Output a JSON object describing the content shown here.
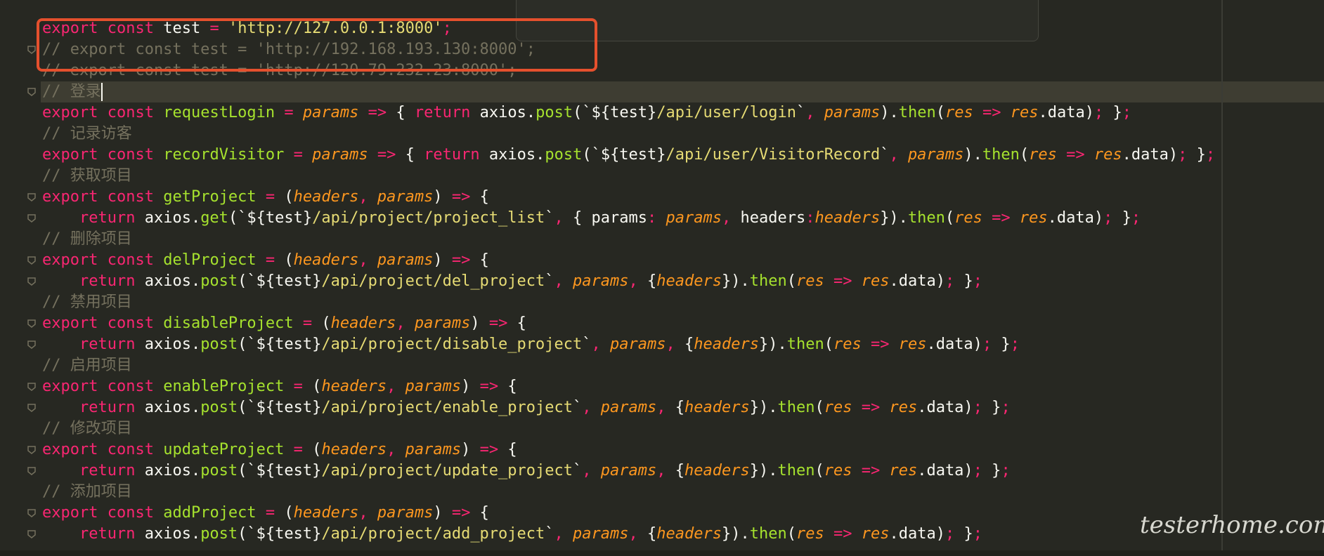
{
  "editor": {
    "lines": [
      [
        [
          "kw",
          "export"
        ],
        [
          "pl",
          " "
        ],
        [
          "kw",
          "const"
        ],
        [
          "pl",
          " test "
        ],
        [
          "op",
          "="
        ],
        [
          "pl",
          " "
        ],
        [
          "st",
          "'http://127.0.0.1:8000'"
        ],
        [
          "op",
          ";"
        ]
      ],
      [
        [
          "cm",
          "// export const test = 'http://192.168.193.130:8000';"
        ]
      ],
      [
        [
          "cm",
          "// export const test = 'http://120.79.232.23:8000';"
        ]
      ],
      [
        [
          "cm",
          "// 登录"
        ]
      ],
      [
        [
          "kw",
          "export"
        ],
        [
          "pl",
          " "
        ],
        [
          "kw",
          "const"
        ],
        [
          "pl",
          " "
        ],
        [
          "fn",
          "requestLogin"
        ],
        [
          "pl",
          " "
        ],
        [
          "op",
          "="
        ],
        [
          "pl",
          " "
        ],
        [
          "pr",
          "params"
        ],
        [
          "pl",
          " "
        ],
        [
          "op",
          "=>"
        ],
        [
          "pl",
          " { "
        ],
        [
          "kw",
          "return"
        ],
        [
          "pl",
          " axios."
        ],
        [
          "fn",
          "post"
        ],
        [
          "pl",
          "(`${test}"
        ],
        [
          "st",
          "/api/user/login"
        ],
        [
          "pl",
          "`"
        ],
        [
          "op",
          ","
        ],
        [
          "pl",
          " "
        ],
        [
          "pr",
          "params"
        ],
        [
          "pl",
          ")."
        ],
        [
          "fn",
          "then"
        ],
        [
          "pl",
          "("
        ],
        [
          "pr",
          "res"
        ],
        [
          "pl",
          " "
        ],
        [
          "op",
          "=>"
        ],
        [
          "pl",
          " "
        ],
        [
          "pr",
          "res"
        ],
        [
          "pl",
          ".data)"
        ],
        [
          "op",
          ";"
        ],
        [
          "pl",
          " }"
        ],
        [
          "op",
          ";"
        ]
      ],
      [
        [
          "cm",
          "// 记录访客"
        ]
      ],
      [
        [
          "kw",
          "export"
        ],
        [
          "pl",
          " "
        ],
        [
          "kw",
          "const"
        ],
        [
          "pl",
          " "
        ],
        [
          "fn",
          "recordVisitor"
        ],
        [
          "pl",
          " "
        ],
        [
          "op",
          "="
        ],
        [
          "pl",
          " "
        ],
        [
          "pr",
          "params"
        ],
        [
          "pl",
          " "
        ],
        [
          "op",
          "=>"
        ],
        [
          "pl",
          " { "
        ],
        [
          "kw",
          "return"
        ],
        [
          "pl",
          " axios."
        ],
        [
          "fn",
          "post"
        ],
        [
          "pl",
          "(`${test}"
        ],
        [
          "st",
          "/api/user/VisitorRecord"
        ],
        [
          "pl",
          "`"
        ],
        [
          "op",
          ","
        ],
        [
          "pl",
          " "
        ],
        [
          "pr",
          "params"
        ],
        [
          "pl",
          ")."
        ],
        [
          "fn",
          "then"
        ],
        [
          "pl",
          "("
        ],
        [
          "pr",
          "res"
        ],
        [
          "pl",
          " "
        ],
        [
          "op",
          "=>"
        ],
        [
          "pl",
          " "
        ],
        [
          "pr",
          "res"
        ],
        [
          "pl",
          ".data)"
        ],
        [
          "op",
          ";"
        ],
        [
          "pl",
          " }"
        ],
        [
          "op",
          ";"
        ]
      ],
      [
        [
          "cm",
          "// 获取项目"
        ]
      ],
      [
        [
          "kw",
          "export"
        ],
        [
          "pl",
          " "
        ],
        [
          "kw",
          "const"
        ],
        [
          "pl",
          " "
        ],
        [
          "fn",
          "getProject"
        ],
        [
          "pl",
          " "
        ],
        [
          "op",
          "="
        ],
        [
          "pl",
          " ("
        ],
        [
          "pr",
          "headers"
        ],
        [
          "op",
          ","
        ],
        [
          "pl",
          " "
        ],
        [
          "pr",
          "params"
        ],
        [
          "pl",
          ") "
        ],
        [
          "op",
          "=>"
        ],
        [
          "pl",
          " {"
        ]
      ],
      [
        [
          "pl",
          "    "
        ],
        [
          "kw",
          "return"
        ],
        [
          "pl",
          " axios."
        ],
        [
          "fn",
          "get"
        ],
        [
          "pl",
          "(`${test}"
        ],
        [
          "st",
          "/api/project/project_list"
        ],
        [
          "pl",
          "`"
        ],
        [
          "op",
          ","
        ],
        [
          "pl",
          " { params"
        ],
        [
          "op",
          ":"
        ],
        [
          "pl",
          " "
        ],
        [
          "pr",
          "params"
        ],
        [
          "op",
          ","
        ],
        [
          "pl",
          " headers"
        ],
        [
          "op",
          ":"
        ],
        [
          "pr",
          "headers"
        ],
        [
          "pl",
          "})."
        ],
        [
          "fn",
          "then"
        ],
        [
          "pl",
          "("
        ],
        [
          "pr",
          "res"
        ],
        [
          "pl",
          " "
        ],
        [
          "op",
          "=>"
        ],
        [
          "pl",
          " "
        ],
        [
          "pr",
          "res"
        ],
        [
          "pl",
          ".data)"
        ],
        [
          "op",
          ";"
        ],
        [
          "pl",
          " }"
        ],
        [
          "op",
          ";"
        ]
      ],
      [
        [
          "cm",
          "// 删除项目"
        ]
      ],
      [
        [
          "kw",
          "export"
        ],
        [
          "pl",
          " "
        ],
        [
          "kw",
          "const"
        ],
        [
          "pl",
          " "
        ],
        [
          "fn",
          "delProject"
        ],
        [
          "pl",
          " "
        ],
        [
          "op",
          "="
        ],
        [
          "pl",
          " ("
        ],
        [
          "pr",
          "headers"
        ],
        [
          "op",
          ","
        ],
        [
          "pl",
          " "
        ],
        [
          "pr",
          "params"
        ],
        [
          "pl",
          ") "
        ],
        [
          "op",
          "=>"
        ],
        [
          "pl",
          " {"
        ]
      ],
      [
        [
          "pl",
          "    "
        ],
        [
          "kw",
          "return"
        ],
        [
          "pl",
          " axios."
        ],
        [
          "fn",
          "post"
        ],
        [
          "pl",
          "(`${test}"
        ],
        [
          "st",
          "/api/project/del_project"
        ],
        [
          "pl",
          "`"
        ],
        [
          "op",
          ","
        ],
        [
          "pl",
          " "
        ],
        [
          "pr",
          "params"
        ],
        [
          "op",
          ","
        ],
        [
          "pl",
          " {"
        ],
        [
          "pr",
          "headers"
        ],
        [
          "pl",
          "})."
        ],
        [
          "fn",
          "then"
        ],
        [
          "pl",
          "("
        ],
        [
          "pr",
          "res"
        ],
        [
          "pl",
          " "
        ],
        [
          "op",
          "=>"
        ],
        [
          "pl",
          " "
        ],
        [
          "pr",
          "res"
        ],
        [
          "pl",
          ".data)"
        ],
        [
          "op",
          ";"
        ],
        [
          "pl",
          " }"
        ],
        [
          "op",
          ";"
        ]
      ],
      [
        [
          "cm",
          "// 禁用项目"
        ]
      ],
      [
        [
          "kw",
          "export"
        ],
        [
          "pl",
          " "
        ],
        [
          "kw",
          "const"
        ],
        [
          "pl",
          " "
        ],
        [
          "fn",
          "disableProject"
        ],
        [
          "pl",
          " "
        ],
        [
          "op",
          "="
        ],
        [
          "pl",
          " ("
        ],
        [
          "pr",
          "headers"
        ],
        [
          "op",
          ","
        ],
        [
          "pl",
          " "
        ],
        [
          "pr",
          "params"
        ],
        [
          "pl",
          ") "
        ],
        [
          "op",
          "=>"
        ],
        [
          "pl",
          " {"
        ]
      ],
      [
        [
          "pl",
          "    "
        ],
        [
          "kw",
          "return"
        ],
        [
          "pl",
          " axios."
        ],
        [
          "fn",
          "post"
        ],
        [
          "pl",
          "(`${test}"
        ],
        [
          "st",
          "/api/project/disable_project"
        ],
        [
          "pl",
          "`"
        ],
        [
          "op",
          ","
        ],
        [
          "pl",
          " "
        ],
        [
          "pr",
          "params"
        ],
        [
          "op",
          ","
        ],
        [
          "pl",
          " {"
        ],
        [
          "pr",
          "headers"
        ],
        [
          "pl",
          "})."
        ],
        [
          "fn",
          "then"
        ],
        [
          "pl",
          "("
        ],
        [
          "pr",
          "res"
        ],
        [
          "pl",
          " "
        ],
        [
          "op",
          "=>"
        ],
        [
          "pl",
          " "
        ],
        [
          "pr",
          "res"
        ],
        [
          "pl",
          ".data)"
        ],
        [
          "op",
          ";"
        ],
        [
          "pl",
          " }"
        ],
        [
          "op",
          ";"
        ]
      ],
      [
        [
          "cm",
          "// 启用项目"
        ]
      ],
      [
        [
          "kw",
          "export"
        ],
        [
          "pl",
          " "
        ],
        [
          "kw",
          "const"
        ],
        [
          "pl",
          " "
        ],
        [
          "fn",
          "enableProject"
        ],
        [
          "pl",
          " "
        ],
        [
          "op",
          "="
        ],
        [
          "pl",
          " ("
        ],
        [
          "pr",
          "headers"
        ],
        [
          "op",
          ","
        ],
        [
          "pl",
          " "
        ],
        [
          "pr",
          "params"
        ],
        [
          "pl",
          ") "
        ],
        [
          "op",
          "=>"
        ],
        [
          "pl",
          " {"
        ]
      ],
      [
        [
          "pl",
          "    "
        ],
        [
          "kw",
          "return"
        ],
        [
          "pl",
          " axios."
        ],
        [
          "fn",
          "post"
        ],
        [
          "pl",
          "(`${test}"
        ],
        [
          "st",
          "/api/project/enable_project"
        ],
        [
          "pl",
          "`"
        ],
        [
          "op",
          ","
        ],
        [
          "pl",
          " "
        ],
        [
          "pr",
          "params"
        ],
        [
          "op",
          ","
        ],
        [
          "pl",
          " {"
        ],
        [
          "pr",
          "headers"
        ],
        [
          "pl",
          "})."
        ],
        [
          "fn",
          "then"
        ],
        [
          "pl",
          "("
        ],
        [
          "pr",
          "res"
        ],
        [
          "pl",
          " "
        ],
        [
          "op",
          "=>"
        ],
        [
          "pl",
          " "
        ],
        [
          "pr",
          "res"
        ],
        [
          "pl",
          ".data)"
        ],
        [
          "op",
          ";"
        ],
        [
          "pl",
          " }"
        ],
        [
          "op",
          ";"
        ]
      ],
      [
        [
          "cm",
          "// 修改项目"
        ]
      ],
      [
        [
          "kw",
          "export"
        ],
        [
          "pl",
          " "
        ],
        [
          "kw",
          "const"
        ],
        [
          "pl",
          " "
        ],
        [
          "fn",
          "updateProject"
        ],
        [
          "pl",
          " "
        ],
        [
          "op",
          "="
        ],
        [
          "pl",
          " ("
        ],
        [
          "pr",
          "headers"
        ],
        [
          "op",
          ","
        ],
        [
          "pl",
          " "
        ],
        [
          "pr",
          "params"
        ],
        [
          "pl",
          ") "
        ],
        [
          "op",
          "=>"
        ],
        [
          "pl",
          " {"
        ]
      ],
      [
        [
          "pl",
          "    "
        ],
        [
          "kw",
          "return"
        ],
        [
          "pl",
          " axios."
        ],
        [
          "fn",
          "post"
        ],
        [
          "pl",
          "(`${test}"
        ],
        [
          "st",
          "/api/project/update_project"
        ],
        [
          "pl",
          "`"
        ],
        [
          "op",
          ","
        ],
        [
          "pl",
          " "
        ],
        [
          "pr",
          "params"
        ],
        [
          "op",
          ","
        ],
        [
          "pl",
          " {"
        ],
        [
          "pr",
          "headers"
        ],
        [
          "pl",
          "})."
        ],
        [
          "fn",
          "then"
        ],
        [
          "pl",
          "("
        ],
        [
          "pr",
          "res"
        ],
        [
          "pl",
          " "
        ],
        [
          "op",
          "=>"
        ],
        [
          "pl",
          " "
        ],
        [
          "pr",
          "res"
        ],
        [
          "pl",
          ".data)"
        ],
        [
          "op",
          ";"
        ],
        [
          "pl",
          " }"
        ],
        [
          "op",
          ";"
        ]
      ],
      [
        [
          "cm",
          "// 添加项目"
        ]
      ],
      [
        [
          "kw",
          "export"
        ],
        [
          "pl",
          " "
        ],
        [
          "kw",
          "const"
        ],
        [
          "pl",
          " "
        ],
        [
          "fn",
          "addProject"
        ],
        [
          "pl",
          " "
        ],
        [
          "op",
          "="
        ],
        [
          "pl",
          " ("
        ],
        [
          "pr",
          "headers"
        ],
        [
          "op",
          ","
        ],
        [
          "pl",
          " "
        ],
        [
          "pr",
          "params"
        ],
        [
          "pl",
          ") "
        ],
        [
          "op",
          "=>"
        ],
        [
          "pl",
          " {"
        ]
      ],
      [
        [
          "pl",
          "    "
        ],
        [
          "kw",
          "return"
        ],
        [
          "pl",
          " axios."
        ],
        [
          "fn",
          "post"
        ],
        [
          "pl",
          "(`${test}"
        ],
        [
          "st",
          "/api/project/add_project"
        ],
        [
          "pl",
          "`"
        ],
        [
          "op",
          ","
        ],
        [
          "pl",
          " "
        ],
        [
          "pr",
          "params"
        ],
        [
          "op",
          ","
        ],
        [
          "pl",
          " {"
        ],
        [
          "pr",
          "headers"
        ],
        [
          "pl",
          "})."
        ],
        [
          "fn",
          "then"
        ],
        [
          "pl",
          "("
        ],
        [
          "pr",
          "res"
        ],
        [
          "pl",
          " "
        ],
        [
          "op",
          "=>"
        ],
        [
          "pl",
          " "
        ],
        [
          "pr",
          "res"
        ],
        [
          "pl",
          ".data)"
        ],
        [
          "op",
          ";"
        ],
        [
          "pl",
          " }"
        ],
        [
          "op",
          ";"
        ]
      ]
    ],
    "cursor_line": 3,
    "fold_markers": [
      1,
      3,
      8,
      9,
      11,
      12,
      14,
      15,
      17,
      18,
      20,
      21,
      23,
      24
    ],
    "theme": {
      "background": "#272822",
      "highlight_box": "#e5502d"
    }
  },
  "watermark": "testerhome.com"
}
